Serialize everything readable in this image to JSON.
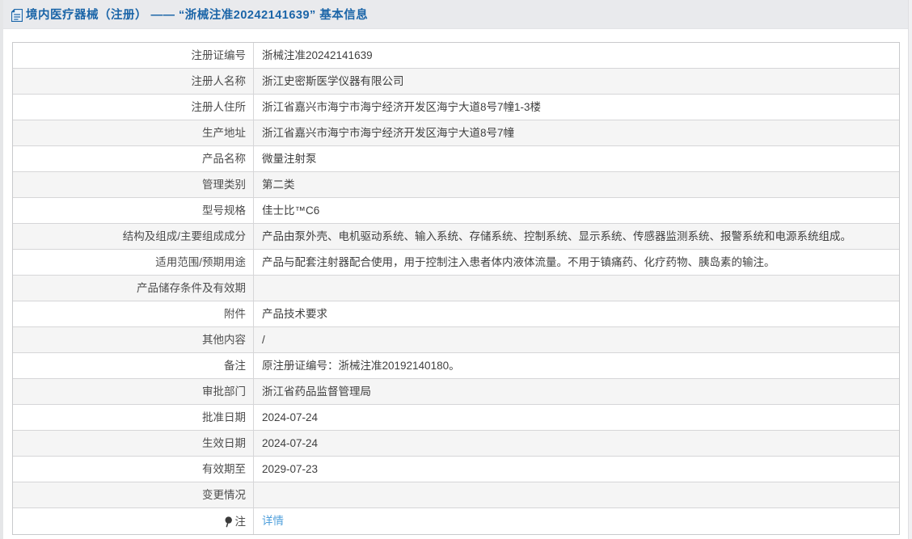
{
  "header": {
    "title": "境内医疗器械（注册） —— “浙械注准20242141639” 基本信息"
  },
  "table": {
    "rows": [
      {
        "label": "注册证编号",
        "value": "浙械注准20242141639"
      },
      {
        "label": "注册人名称",
        "value": "浙江史密斯医学仪器有限公司"
      },
      {
        "label": "注册人住所",
        "value": "浙江省嘉兴市海宁市海宁经济开发区海宁大道8号7幢1-3楼"
      },
      {
        "label": "生产地址",
        "value": "浙江省嘉兴市海宁市海宁经济开发区海宁大道8号7幢"
      },
      {
        "label": "产品名称",
        "value": "微量注射泵"
      },
      {
        "label": "管理类别",
        "value": "第二类"
      },
      {
        "label": "型号规格",
        "value": "佳士比™C6"
      },
      {
        "label": "结构及组成/主要组成成分",
        "value": "产品由泵外壳、电机驱动系统、输入系统、存储系统、控制系统、显示系统、传感器监测系统、报警系统和电源系统组成。"
      },
      {
        "label": "适用范围/预期用途",
        "value": "产品与配套注射器配合使用，用于控制注入患者体内液体流量。不用于镇痛药、化疗药物、胰岛素的输注。"
      },
      {
        "label": "产品储存条件及有效期",
        "value": ""
      },
      {
        "label": "附件",
        "value": "产品技术要求"
      },
      {
        "label": "其他内容",
        "value": "/"
      },
      {
        "label": "备注",
        "value": "原注册证编号：浙械注准20192140180。"
      },
      {
        "label": "审批部门",
        "value": "浙江省药品监督管理局"
      },
      {
        "label": "批准日期",
        "value": "2024-07-24"
      },
      {
        "label": "生效日期",
        "value": "2024-07-24"
      },
      {
        "label": "有效期至",
        "value": "2029-07-23"
      },
      {
        "label": "变更情况",
        "value": ""
      },
      {
        "label": "注",
        "value": "详情"
      }
    ]
  },
  "icons": {
    "header_icon": "document-icon",
    "note_icon": "note-balloon-icon"
  },
  "colors": {
    "accent_blue": "#1b65a8",
    "link_blue": "#4f9fdb",
    "topbar_bg": "#e9eaed",
    "row_alt_bg": "#f5f5f5",
    "border": "#d6d6d8"
  }
}
